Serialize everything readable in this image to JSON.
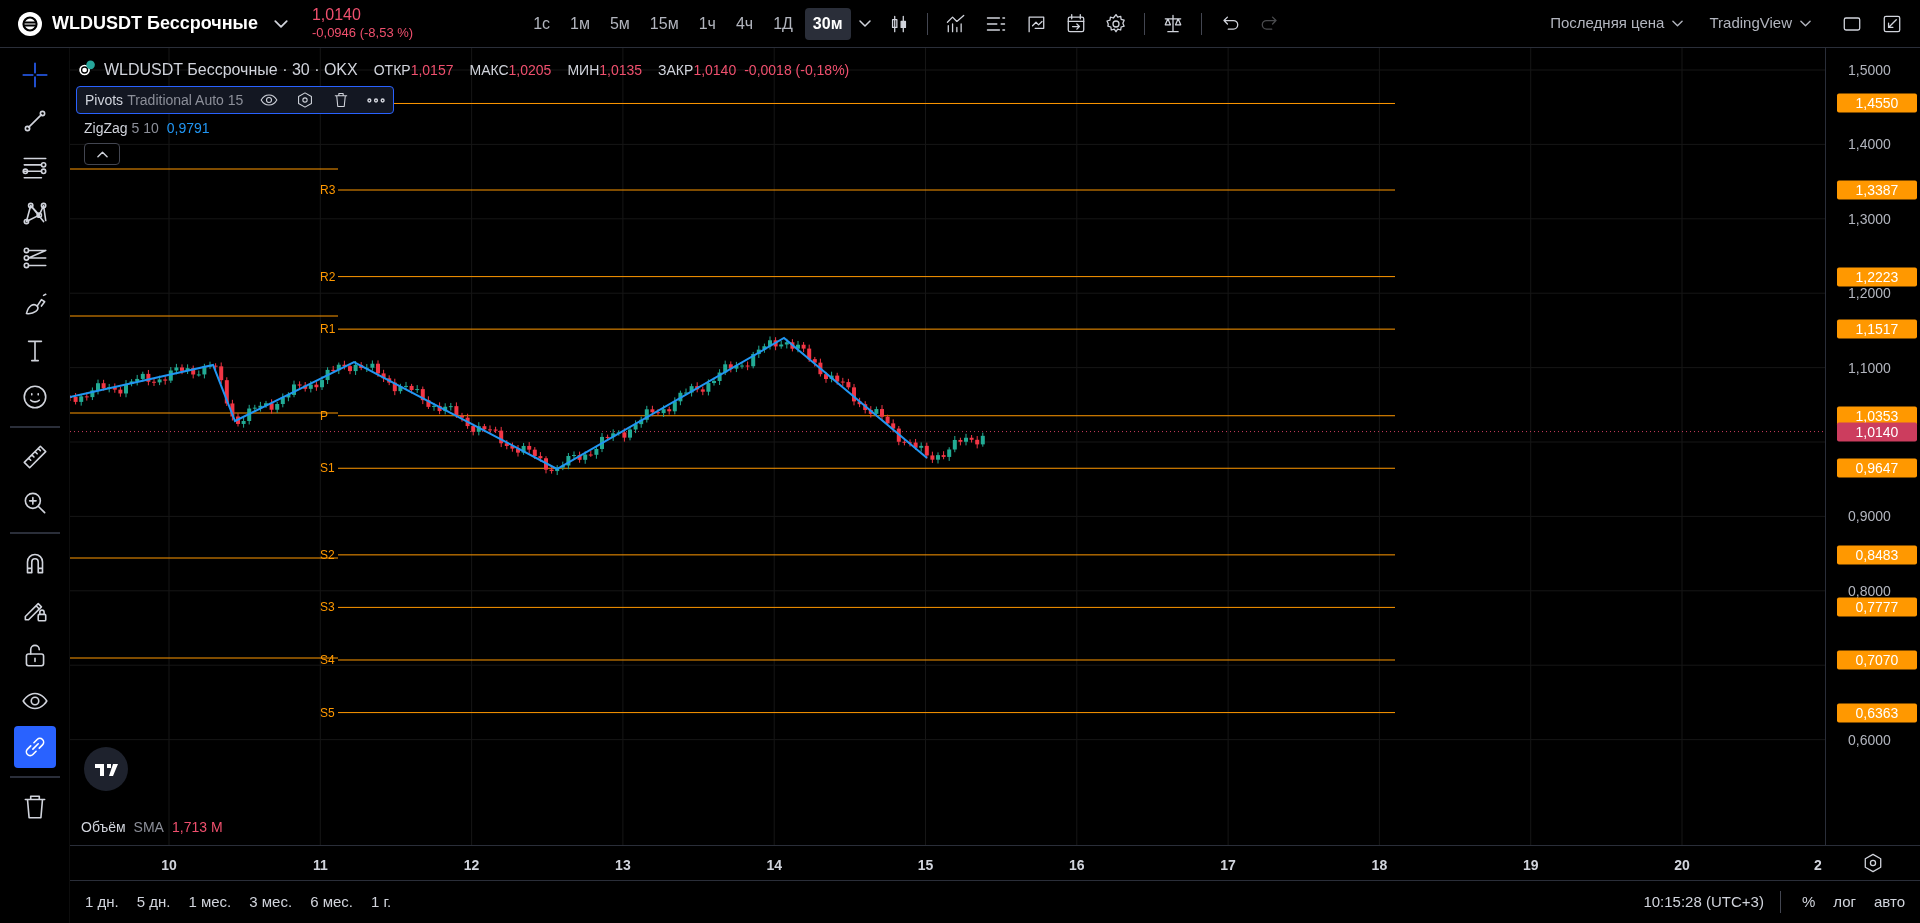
{
  "header": {
    "symbol": "WLDUSDT Бессрочные",
    "last_price": "1,0140",
    "change": "-0,0946 (-8,53 %)",
    "intervals": [
      {
        "label": "1с",
        "selected": false
      },
      {
        "label": "1м",
        "selected": false
      },
      {
        "label": "5м",
        "selected": false
      },
      {
        "label": "15м",
        "selected": false
      },
      {
        "label": "1ч",
        "selected": false
      },
      {
        "label": "4ч",
        "selected": false
      },
      {
        "label": "1Д",
        "selected": false
      },
      {
        "label": "30м",
        "selected": true
      }
    ],
    "price_source": "Последняя цена",
    "chart_source": "TradingView",
    "history": {
      "redo_disabled": true
    }
  },
  "left_toolbar": {
    "tools": [
      {
        "kind": "tool",
        "selected": true
      },
      {
        "kind": "tool",
        "selected": false
      },
      {
        "kind": "tool",
        "selected": false
      },
      {
        "kind": "tool",
        "selected": false
      },
      {
        "kind": "tool",
        "selected": false
      },
      {
        "kind": "tool",
        "selected": false
      },
      {
        "kind": "tool",
        "selected": false
      },
      {
        "kind": "tool",
        "selected": false
      },
      {
        "kind": "tool",
        "selected": false
      },
      {
        "kind": "tool",
        "selected": false
      },
      {
        "kind": "tool",
        "selected": false
      },
      {
        "kind": "tool",
        "selected": false
      },
      {
        "kind": "tool",
        "selected": false
      },
      {
        "kind": "tool",
        "selected": false
      },
      {
        "kind": "toggle",
        "on": true
      },
      {
        "kind": "tool",
        "selected": false
      }
    ]
  },
  "legend": {
    "title": "WLDUSDT Бессрочные · 30 · OKX",
    "ohlc": [
      {
        "label": "ОТКР",
        "value": "1,0157"
      },
      {
        "label": "МАКС",
        "value": "1,0205"
      },
      {
        "label": "МИН",
        "value": "1,0135"
      },
      {
        "label": "ЗАКР",
        "value": "1,0140"
      }
    ],
    "change": "-0,0018 (-0,18%)"
  },
  "indicators": [
    {
      "name": "Pivots",
      "params": "Traditional Auto 15",
      "selected": true
    },
    {
      "name": "ZigZag",
      "params": "5 10",
      "value": "0,9791",
      "selected": false
    }
  ],
  "volume": {
    "name": "Объём",
    "ma": "SMA",
    "value": "1,713 M"
  },
  "pivot_levels": [
    {
      "value": "1,4550"
    },
    {
      "label": "R3",
      "value": "1,3387"
    },
    {
      "label": "R2",
      "value": "1,2223"
    },
    {
      "label": "R1",
      "value": "1,1517"
    },
    {
      "label": "P",
      "value": "1,0353"
    },
    {
      "label": "S1",
      "value": "0,9647"
    },
    {
      "label": "S2",
      "value": "0,8483"
    },
    {
      "label": "S3",
      "value": "0,7777"
    },
    {
      "label": "S4",
      "value": "0,7070"
    },
    {
      "label": "S5",
      "value": "0,6363"
    }
  ],
  "price_axis": {
    "ticks": [
      "1,5000",
      "1,4000",
      "1,3000",
      "1,2000",
      "1,1000",
      "0,9000",
      "0,8000",
      "0,6000"
    ],
    "last_price": "1,0140"
  },
  "time_axis": {
    "ticks": [
      "10",
      "11",
      "12",
      "13",
      "14",
      "15",
      "16",
      "17",
      "18",
      "19",
      "20",
      "2"
    ]
  },
  "bottom_bar": {
    "ranges": [
      "1 дн.",
      "5 дн.",
      "1 мес.",
      "3 мес.",
      "6 мес.",
      "1 г."
    ],
    "clock": "10:15:28 (UTC+3)",
    "toggles": [
      "%",
      "лог",
      "авто"
    ]
  }
}
